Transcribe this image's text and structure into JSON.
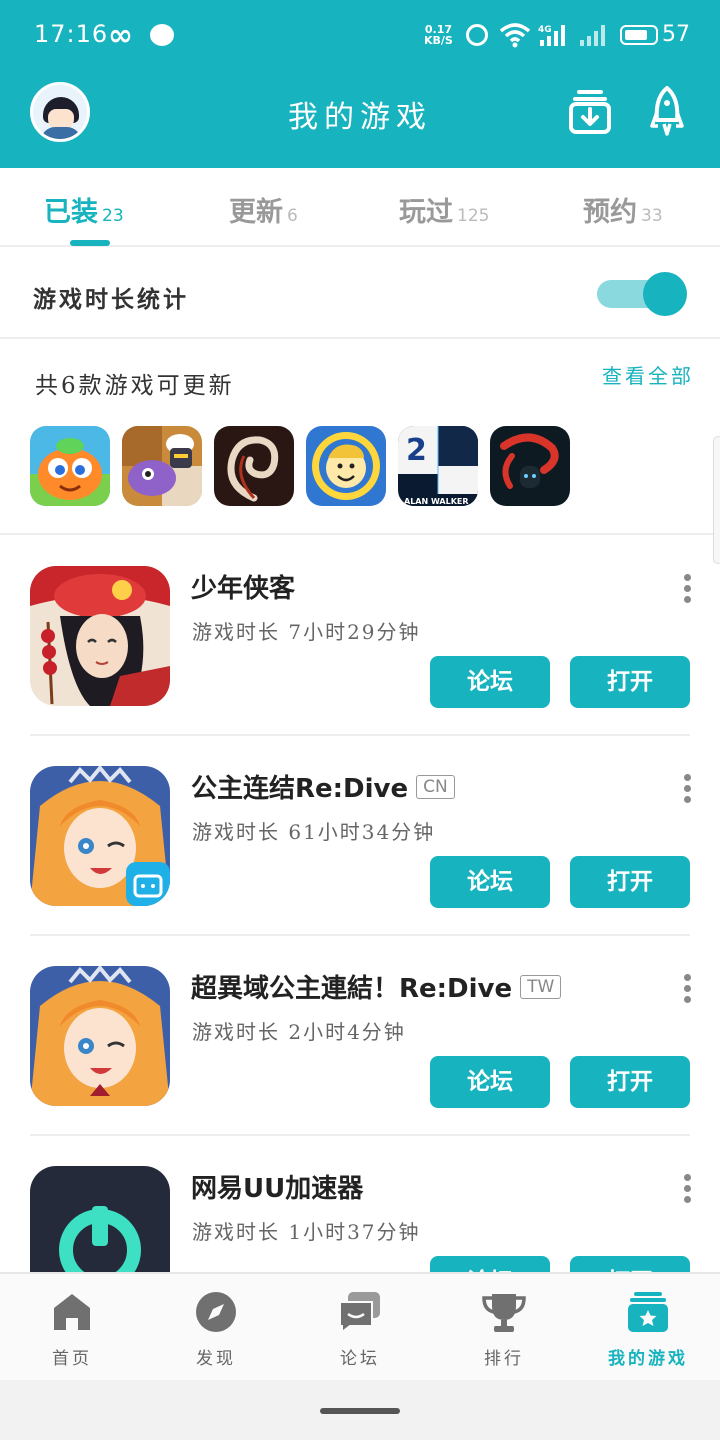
{
  "status_bar": {
    "time": "17:16",
    "infinity": "∞",
    "net_speed_value": "0.17",
    "net_speed_unit": "KB/S",
    "battery": "57"
  },
  "header": {
    "title": "我的游戏"
  },
  "tabs": [
    {
      "label": "已装",
      "count": "23"
    },
    {
      "label": "更新",
      "count": "6"
    },
    {
      "label": "玩过",
      "count": "125"
    },
    {
      "label": "预约",
      "count": "33"
    }
  ],
  "stats_toggle": {
    "label": "游戏时长统计",
    "enabled": true
  },
  "updates": {
    "title": "共6款游戏可更新",
    "view_all": "查看全部",
    "app_icons": [
      "fruit-game-icon",
      "cooking-robot-game-icon",
      "dark-swirl-game-icon",
      "fallout-vault-boy-icon",
      "piano-tiles-alan-walker-icon",
      "red-scarf-shadow-game-icon"
    ],
    "piano_tiles_number": "2",
    "piano_tiles_caption": "ALAN WALKER"
  },
  "games": [
    {
      "name": "少年侠客",
      "region": "",
      "playtime": "游戏时长 7小时29分钟",
      "forum_label": "论坛",
      "open_label": "打开"
    },
    {
      "name": "公主连结Re:Dive",
      "region": "CN",
      "playtime": "游戏时长 61小时34分钟",
      "forum_label": "论坛",
      "open_label": "打开"
    },
    {
      "name": "超異域公主連結！Re:Dive",
      "region": "TW",
      "playtime": "游戏时长 2小时4分钟",
      "forum_label": "论坛",
      "open_label": "打开"
    },
    {
      "name": "网易UU加速器",
      "region": "",
      "playtime": "游戏时长 1小时37分钟",
      "forum_label": "论坛",
      "open_label": "打开"
    }
  ],
  "bottom_nav": [
    {
      "label": "首页",
      "icon": "home-icon"
    },
    {
      "label": "发现",
      "icon": "compass-icon"
    },
    {
      "label": "论坛",
      "icon": "forum-chat-icon"
    },
    {
      "label": "排行",
      "icon": "trophy-icon"
    },
    {
      "label": "我的游戏",
      "icon": "my-games-icon",
      "active": true
    }
  ],
  "colors": {
    "accent": "#17b3bf",
    "toggle_track": "#8ad9df",
    "text_primary": "#222222",
    "text_secondary": "#666666"
  }
}
